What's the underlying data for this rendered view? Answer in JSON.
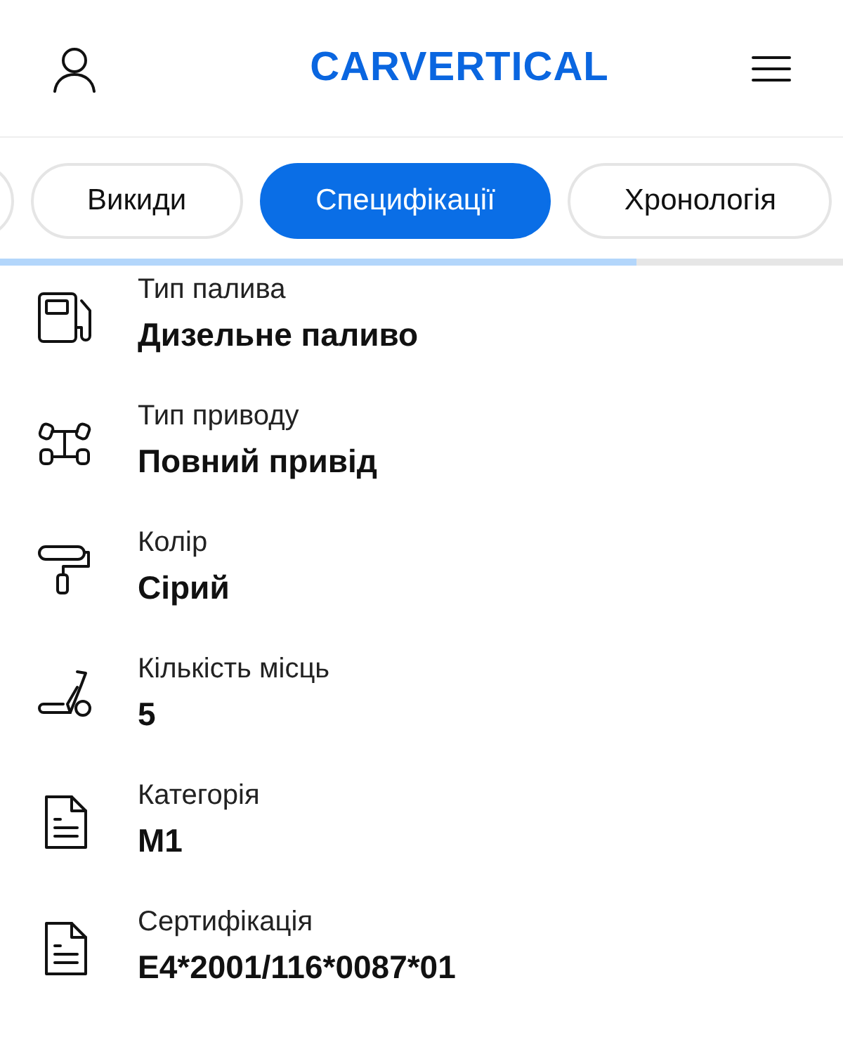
{
  "header": {
    "logo": "CARVERTICAL"
  },
  "tabs": [
    {
      "label": "Викиди",
      "selected": false
    },
    {
      "label": "Специфікації",
      "selected": true
    },
    {
      "label": "Хронологія",
      "selected": false
    }
  ],
  "progress": {
    "level": 0.755
  },
  "specs": [
    {
      "label": "Тип палива",
      "value": "Дизельне паливо"
    },
    {
      "label": "Тип приводу",
      "value": "Повний привід"
    },
    {
      "label": "Колір",
      "value": "Сірий"
    },
    {
      "label": "Кількість місць",
      "value": "5"
    },
    {
      "label": "Категорія",
      "value": "M1"
    },
    {
      "label": "Сертифікація",
      "value": "E4*2001/116*0087*01"
    }
  ]
}
